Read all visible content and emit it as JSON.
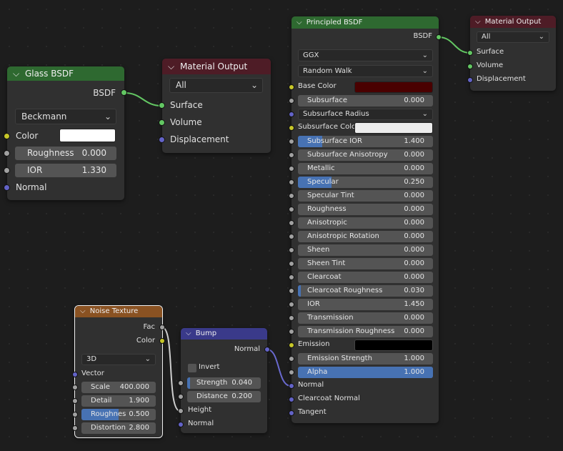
{
  "colors": {
    "background": "#1d1d1d",
    "node_body": "#303030",
    "header_shader": "#2e6930",
    "header_output": "#4e1c26",
    "header_texture": "#8a5222",
    "header_vector": "#3a3a8a",
    "field": "#545454",
    "field_fill": "#4772b3",
    "socket_shader": "#63c763",
    "socket_color": "#c7c729",
    "socket_float": "#a1a1a1",
    "socket_vector": "#6363c7",
    "base_color": "#4a0000",
    "glass_color": "#ffffff",
    "subsurface_color": "#ececec",
    "emission_color": "#000000"
  },
  "glass_bsdf": {
    "title": "Glass BSDF",
    "output_bsdf": "BSDF",
    "distribution": "Beckmann",
    "color_label": "Color",
    "roughness_label": "Roughness",
    "roughness_value": "0.000",
    "ior_label": "IOR",
    "ior_value": "1.330",
    "normal_label": "Normal"
  },
  "material_output_1": {
    "title": "Material Output",
    "target": "All",
    "surface": "Surface",
    "volume": "Volume",
    "displacement": "Displacement"
  },
  "material_output_2": {
    "title": "Material Output",
    "target": "All",
    "surface": "Surface",
    "volume": "Volume",
    "displacement": "Displacement"
  },
  "principled_bsdf": {
    "title": "Principled BSDF",
    "output_bsdf": "BSDF",
    "distribution": "GGX",
    "subsurface_method": "Random Walk",
    "base_color_label": "Base Color",
    "subsurface_label": "Subsurface",
    "subsurface_value": "0.000",
    "subsurface_radius_label": "Subsurface Radius",
    "subsurface_color_label": "Subsurface Colo",
    "fields": [
      {
        "label": "Subsurface IOR",
        "value": "1.400",
        "fill": 0.18
      },
      {
        "label": "Subsurface Anisotropy",
        "value": "0.000",
        "fill": 0
      },
      {
        "label": "Metallic",
        "value": "0.000",
        "fill": 0
      },
      {
        "label": "Specular",
        "value": "0.250",
        "fill": 0.25
      },
      {
        "label": "Specular Tint",
        "value": "0.000",
        "fill": 0
      },
      {
        "label": "Roughness",
        "value": "0.000",
        "fill": 0
      },
      {
        "label": "Anisotropic",
        "value": "0.000",
        "fill": 0
      },
      {
        "label": "Anisotropic Rotation",
        "value": "0.000",
        "fill": 0
      },
      {
        "label": "Sheen",
        "value": "0.000",
        "fill": 0
      },
      {
        "label": "Sheen Tint",
        "value": "0.000",
        "fill": 0
      },
      {
        "label": "Clearcoat",
        "value": "0.000",
        "fill": 0
      },
      {
        "label": "Clearcoat Roughness",
        "value": "0.030",
        "fill": 0.03
      },
      {
        "label": "IOR",
        "value": "1.450",
        "fill": 0
      },
      {
        "label": "Transmission",
        "value": "0.000",
        "fill": 0
      },
      {
        "label": "Transmission Roughness",
        "value": "0.000",
        "fill": 0
      }
    ],
    "emission_label": "Emission",
    "emission_strength_label": "Emission Strength",
    "emission_strength_value": "1.000",
    "alpha_label": "Alpha",
    "alpha_value": "1.000",
    "alpha_fill": 1.0,
    "normal_label": "Normal",
    "clearcoat_normal_label": "Clearcoat Normal",
    "tangent_label": "Tangent"
  },
  "noise_texture": {
    "title": "Noise Texture",
    "output_fac": "Fac",
    "output_color": "Color",
    "dimensions": "3D",
    "vector_label": "Vector",
    "fields": [
      {
        "label": "Scale",
        "value": "400.000",
        "fill": 0
      },
      {
        "label": "Detail",
        "value": "1.900",
        "fill": 0
      },
      {
        "label": "Roughnes",
        "value": "0.500",
        "fill": 0.5
      },
      {
        "label": "Distortion",
        "value": "2.800",
        "fill": 0
      }
    ]
  },
  "bump": {
    "title": "Bump",
    "output_normal": "Normal",
    "invert_label": "Invert",
    "invert_checked": false,
    "strength_label": "Strength",
    "strength_value": "0.040",
    "strength_fill": 0.04,
    "distance_label": "Distance",
    "distance_value": "0.200",
    "distance_fill": 0,
    "height_label": "Height",
    "normal_label": "Normal"
  }
}
